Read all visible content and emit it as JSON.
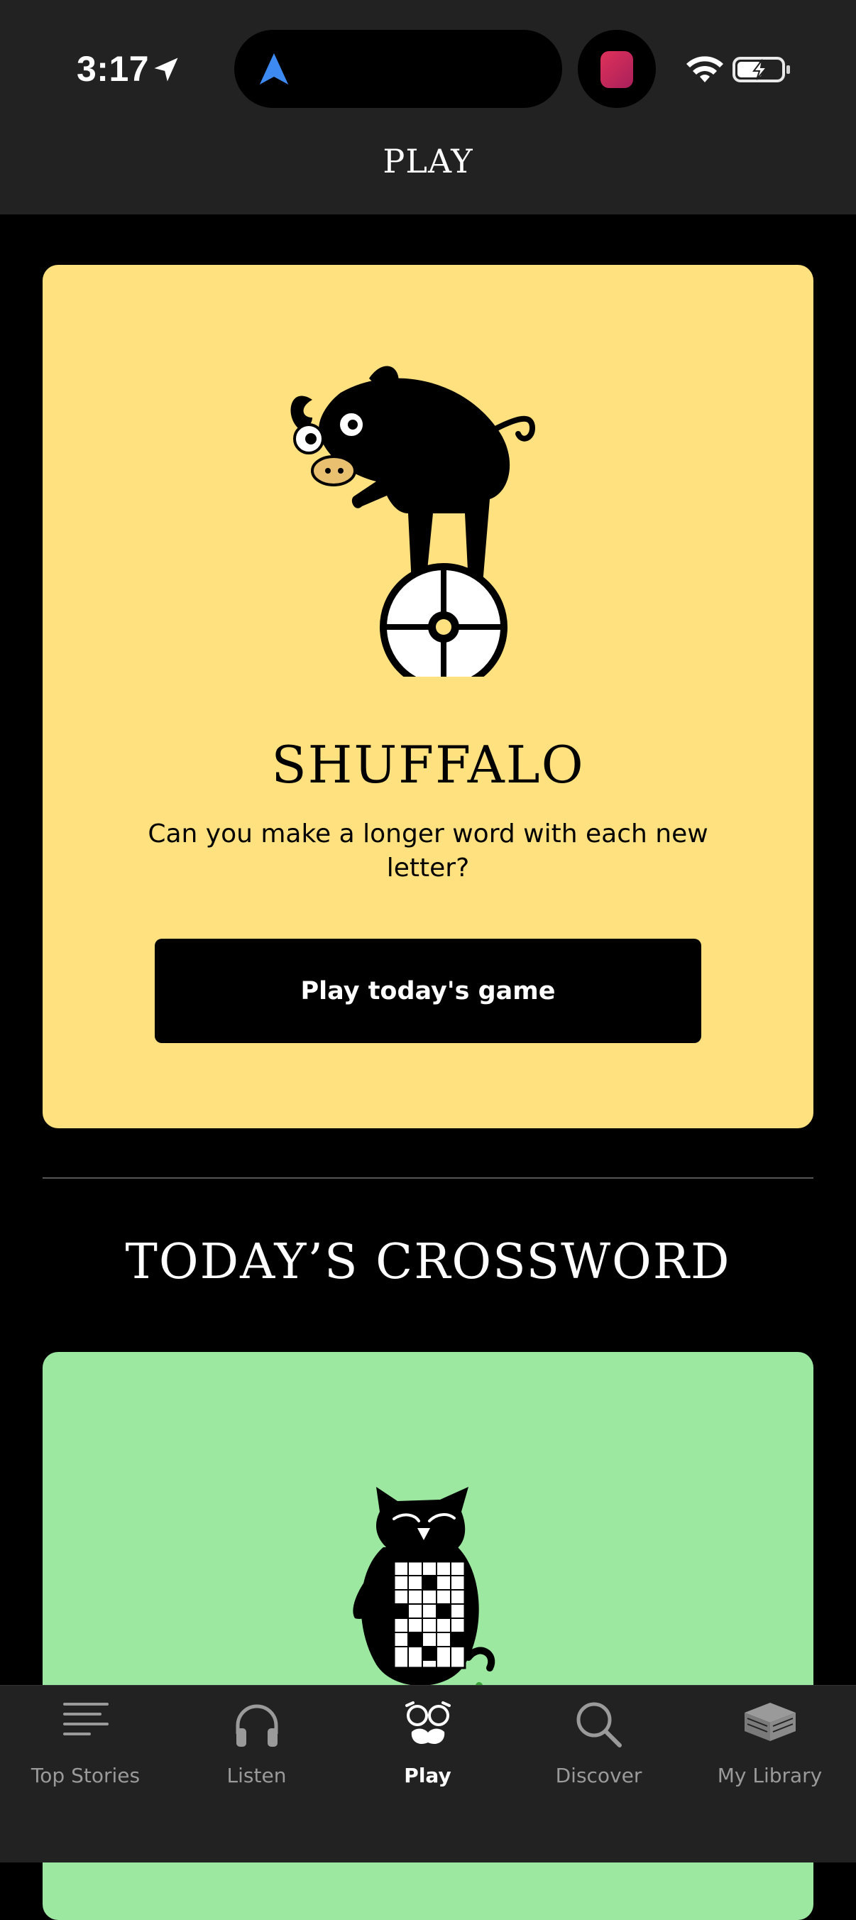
{
  "status_bar": {
    "time": "3:17"
  },
  "header": {
    "title": "PLAY"
  },
  "shuffalo": {
    "title": "SHUFFALO",
    "description": "Can you make a longer word with each new letter?",
    "button_label": "Play today's game",
    "bg_color": "#ffe180"
  },
  "crossword": {
    "heading": "TODAY’S CROSSWORD",
    "bg_color": "#9ce8a0"
  },
  "tabs": [
    {
      "label": "Top Stories",
      "icon": "top-stories-icon"
    },
    {
      "label": "Listen",
      "icon": "headphones-icon"
    },
    {
      "label": "Play",
      "icon": "play-mask-icon",
      "active": true
    },
    {
      "label": "Discover",
      "icon": "search-icon"
    },
    {
      "label": "My Library",
      "icon": "library-icon"
    }
  ]
}
